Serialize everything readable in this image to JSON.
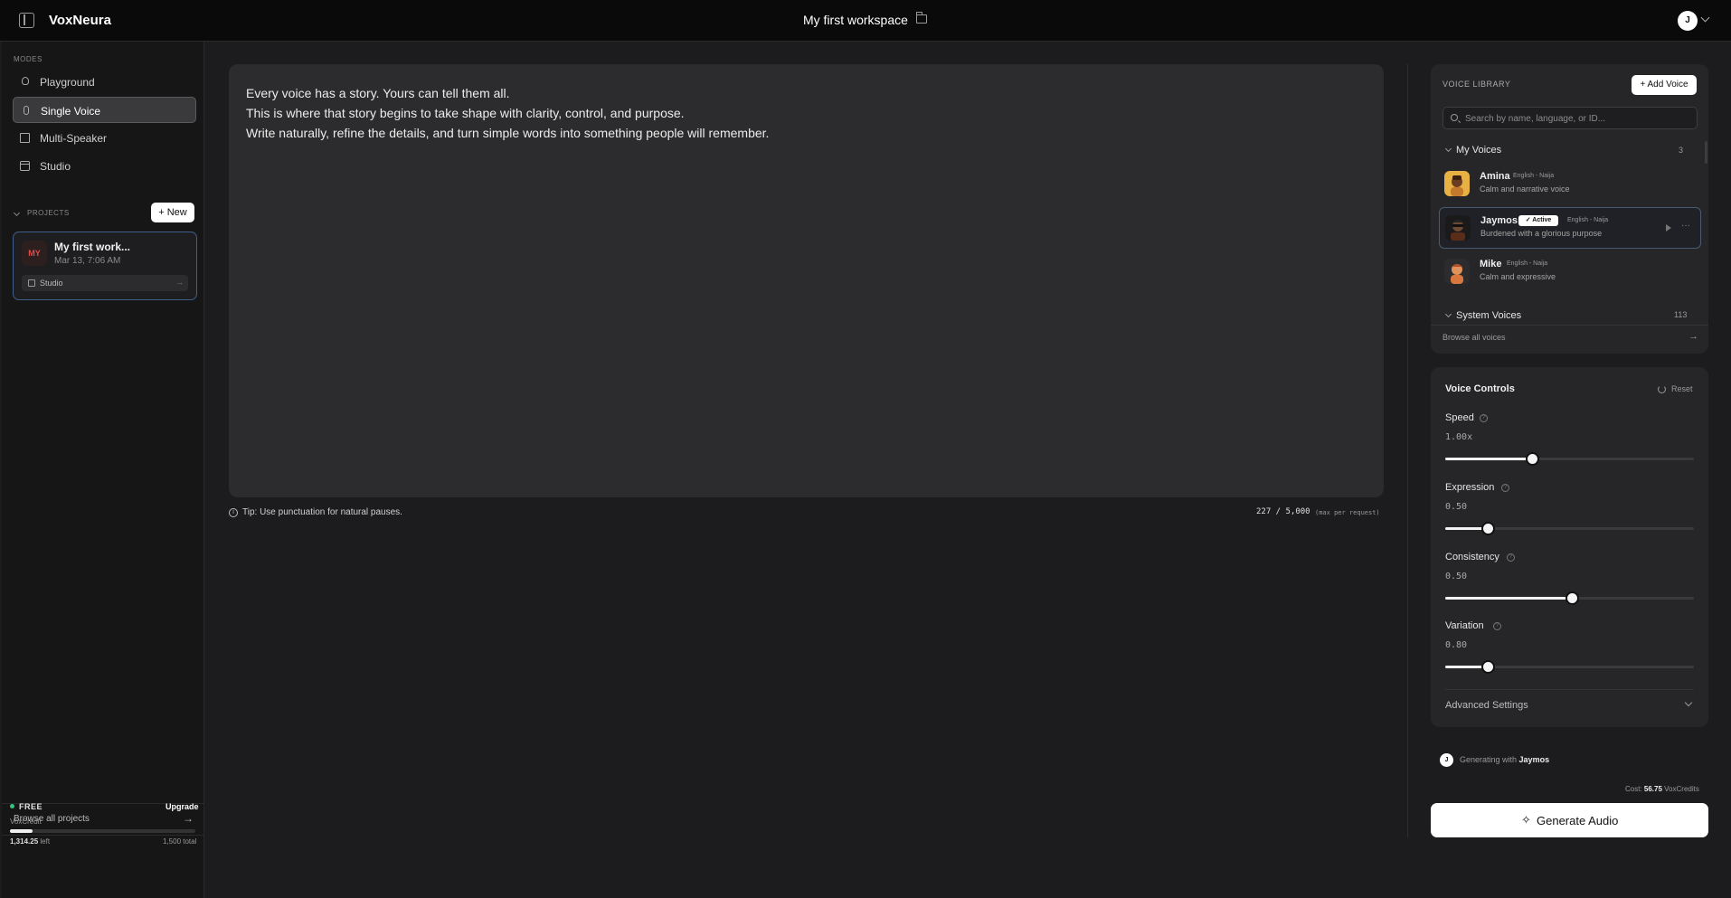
{
  "app": {
    "brand": "VoxNeura",
    "workspace_title": "My first workspace",
    "user_initial": "J"
  },
  "sidebar": {
    "modes_label": "MODES",
    "modes": [
      {
        "label": "Playground",
        "icon": "bulb-icon"
      },
      {
        "label": "Single Voice",
        "icon": "mic-icon",
        "active": true
      },
      {
        "label": "Multi-Speaker",
        "icon": "chat-icon"
      },
      {
        "label": "Studio",
        "icon": "studio-icon"
      }
    ],
    "projects_label": "PROJECTS",
    "new_button": "New",
    "project": {
      "initials": "MY",
      "name": "My first work...",
      "date": "Mar 13, 7:06 AM",
      "tag": "Studio"
    },
    "browse_all": "Browse all projects",
    "plan": "FREE",
    "upgrade": "Upgrade",
    "credit_label": "VoxCredit",
    "credits_left": "1,314.25",
    "credits_left_suffix": " left",
    "credits_total": "1,500 total",
    "credit_fraction": 0.12
  },
  "editor": {
    "lines": [
      "Every voice has a story. Yours can tell them all.",
      "This is where that story begins to take shape with clarity, control, and purpose.",
      "Write naturally, refine the details, and turn simple words into something people will remember."
    ],
    "tip": "Tip: Use punctuation for natural pauses.",
    "char_count": "227 / 5,000",
    "char_note": "(max per request)"
  },
  "voice_library": {
    "title": "VOICE LIBRARY",
    "add_button": "+ Add Voice",
    "search_placeholder": "Search by name, language, or ID...",
    "my_voices_title": "My Voices",
    "my_voices_count": "3",
    "voices": [
      {
        "name": "Amina",
        "lang": "English - Naija",
        "desc": "Calm and narrative voice"
      },
      {
        "name": "Jaymos",
        "lang": "English - Naija",
        "desc": "Burdened with a glorious purpose",
        "active": true,
        "badge": "✓ Active"
      },
      {
        "name": "Mike",
        "lang": "English - Naija",
        "desc": "Calm and expressive"
      }
    ],
    "system_voices_title": "System Voices",
    "system_voices_count": "113",
    "browse_all": "Browse all voices"
  },
  "voice_controls": {
    "title": "Voice Controls",
    "reset": "Reset",
    "controls": [
      {
        "label": "Speed",
        "value_text": "1.00x",
        "fraction": 0.35
      },
      {
        "label": "Expression",
        "value_text": "0.50",
        "fraction": 0.17
      },
      {
        "label": "Consistency",
        "value_text": "0.50",
        "fraction": 0.51
      },
      {
        "label": "Variation",
        "value_text": "0.80",
        "fraction": 0.17
      }
    ],
    "advanced": "Advanced Settings"
  },
  "generate": {
    "avatar_initial": "J",
    "generating_with": "Generating with ",
    "voice": "Jaymos",
    "cost_prefix": "Cost: ",
    "cost_value": "56.75",
    "cost_suffix": " VoxCredits",
    "button": "Generate Audio"
  }
}
